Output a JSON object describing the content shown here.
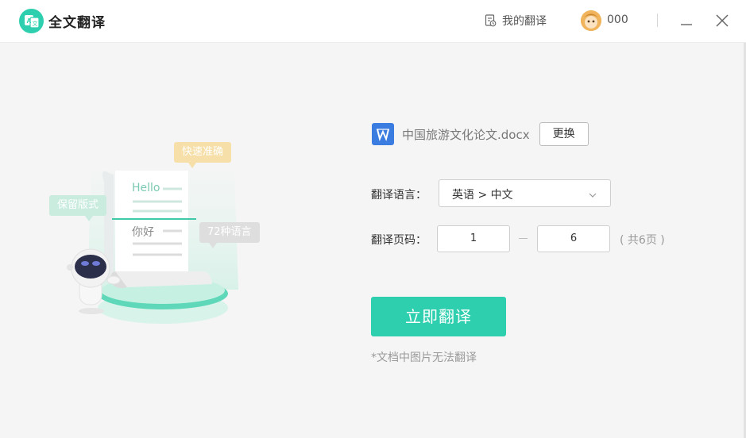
{
  "app": {
    "title": "全文翻译",
    "logo_icon": "translate-logo-icon"
  },
  "header": {
    "my_translations": "我的翻译",
    "username": "000"
  },
  "illustration": {
    "bubble_fast": "快速准确",
    "bubble_format": "保留版式",
    "bubble_langs": "72种语言",
    "doc_hello": "Hello",
    "doc_nihao": "你好"
  },
  "file": {
    "name": "中国旅游文化论文.docx",
    "change_label": "更换",
    "icon": "word-doc-icon"
  },
  "form": {
    "lang_label": "翻译语言：",
    "lang_value": "英语 > 中文",
    "pages_label": "翻译页码：",
    "page_from": "1",
    "page_to": "6",
    "total_pages": "( 共6页 )"
  },
  "actions": {
    "translate_label": "立即翻译",
    "note": "*文档中图片无法翻译"
  },
  "colors": {
    "accent": "#2ecfae",
    "word_blue": "#3b7ce1",
    "bubble_yellow": "#f6dfa8",
    "bubble_green": "#c9ecdf",
    "bubble_gray": "#dedede"
  }
}
